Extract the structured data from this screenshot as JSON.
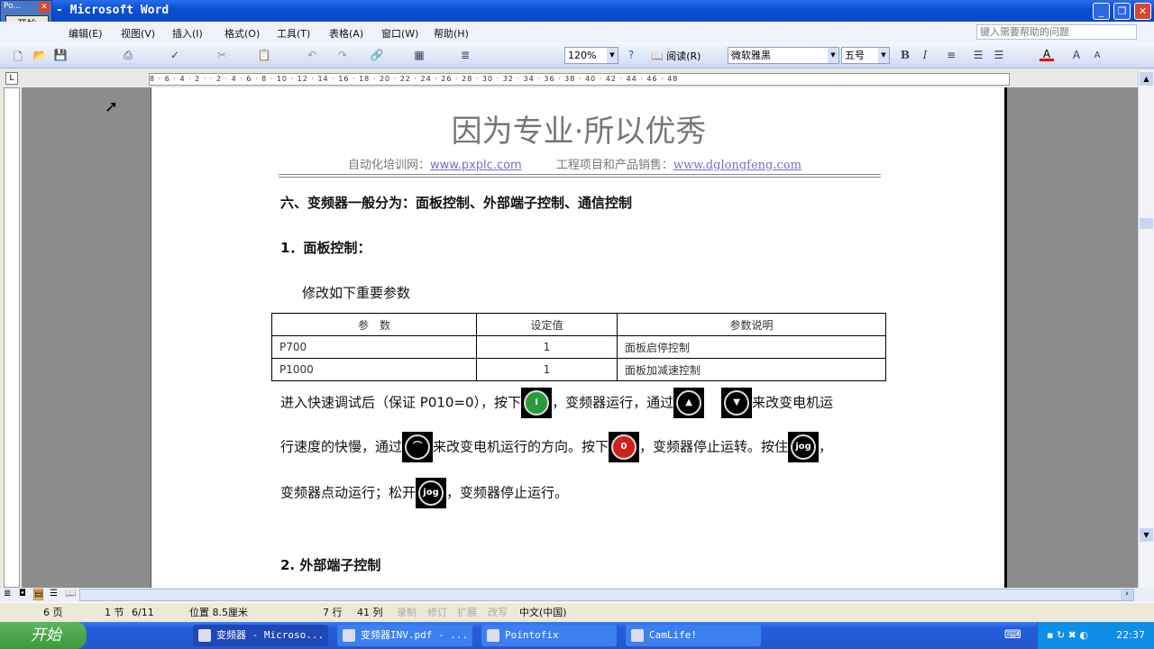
{
  "window": {
    "title": "- Microsoft Word",
    "popup_title": "Po...",
    "popup_button": "开始"
  },
  "menu": [
    "编辑(E)",
    "视图(V)",
    "插入(I)",
    "格式(O)",
    "工具(T)",
    "表格(A)",
    "窗口(W)",
    "帮助(H)"
  ],
  "help_placeholder": "键入需要帮助的问题",
  "toolbar": {
    "zoom": "120%",
    "read": "阅读(R)",
    "font": "微软雅黑",
    "size": "五号",
    "bold": "B",
    "italic": "I"
  },
  "ruler": "8 · 6 · 4 · 2 · · 2 · 4 · 6 · 8 · 10 · 12 · 14 · 16 · 18 · 20 · 22 · 24 · 26 · 28 · 30 · 32 · 34 · 36 · 38 · 40 · 42 · 44 · 46 · 48",
  "doc": {
    "header_title": "因为专业·所以优秀",
    "sub_label1": "自动化培训网：",
    "sub_link1": "www.pxplc.com",
    "sub_label2": "工程项目和产品销售：",
    "sub_link2": "www.dglongfeng.com",
    "h6": "六、变频器一般分为：面板控制、外部端子控制、通信控制",
    "h1": "1．面板控制：",
    "intro": "修改如下重要参数",
    "table": {
      "headers": [
        "参　数",
        "设定值",
        "参数说明"
      ],
      "rows": [
        [
          "P700",
          "1",
          "面板启停控制"
        ],
        [
          "P1000",
          "1",
          "面板加减速控制"
        ]
      ]
    },
    "p1a": "进入快速调试后（保证 P010=0），按下",
    "p1b": "，变频器运行，通过",
    "p1c": "来改变电机运",
    "p2a": "行速度的快慢，通过",
    "p2b": "来改变电机运行的方向。按下",
    "p2c": "，变频器停止运转。按住",
    "p2d": "，",
    "p3a": "变频器点动运行；松开",
    "p3b": "，变频器停止运行。",
    "keys": {
      "run": "I",
      "stop": "0",
      "jog": "jog"
    },
    "h2": "2. 外部端子控制"
  },
  "status": {
    "page": "6 页",
    "section": "1 节",
    "pages": "6/11",
    "position": "位置 8.5厘米",
    "line": "7 行",
    "col": "41 列",
    "rec": "录制",
    "rev": "修订",
    "ext": "扩展",
    "ovr": "改写",
    "lang": "中文(中国)"
  },
  "taskbar": {
    "start": "开始",
    "tasks": [
      "变频器 - Microso...",
      "变频器INV.pdf - ...",
      "Pointofix",
      "CamLife!"
    ],
    "clock": "22:37"
  }
}
